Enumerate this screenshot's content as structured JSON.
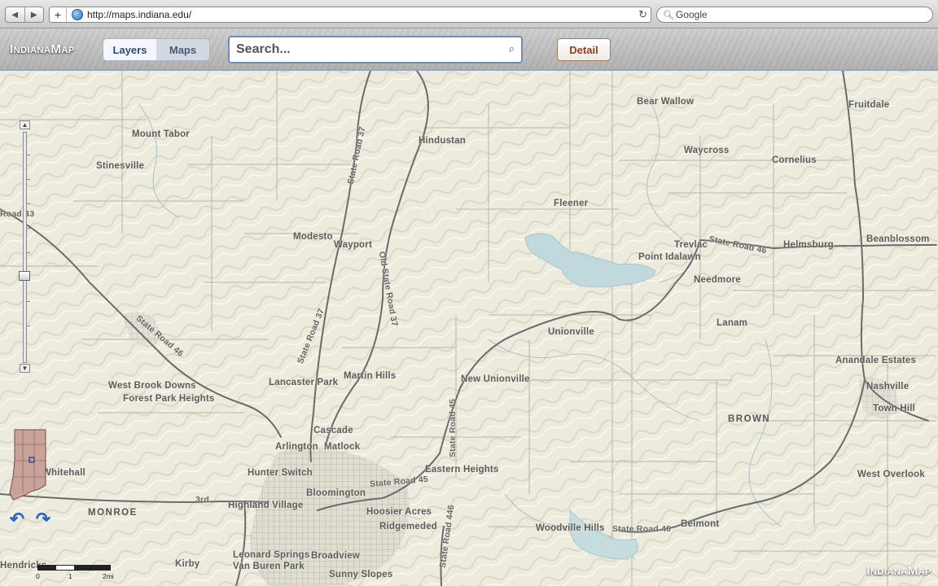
{
  "browser": {
    "back_icon": "back-arrow-icon",
    "forward_icon": "forward-arrow-icon",
    "new_tab": "+",
    "url": "http://maps.indiana.edu/",
    "search_engine": "Google"
  },
  "app": {
    "logo": "IndianaMap",
    "tabs": [
      "Layers",
      "Maps"
    ],
    "search_placeholder": "Search...",
    "detail_button": "Detail",
    "watermark": "IndianaMap"
  },
  "map": {
    "places": [
      "Mount Tabor",
      "Stinesville",
      "Hindustan",
      "Bear Wallow",
      "Fruitdale",
      "Waycross",
      "Cornelius",
      "Fleener",
      "Modesto",
      "Wayport",
      "Trevlac",
      "Helmsburg",
      "Beanblossom",
      "Point Idalawn",
      "Needmore",
      "Lanam",
      "Unionville",
      "West Brook Downs",
      "Forest Park Heights",
      "Lancaster Park",
      "Martin Hills",
      "New Unionville",
      "Anandale Estates",
      "Nashville",
      "Town Hill",
      "Cascade",
      "Arlington",
      "Matlock",
      "Hunter Switch",
      "Bloomington",
      "Eastern Heights",
      "West Overlook",
      "Highland Village",
      "Hoosier Acres",
      "Ridgemeded",
      "Woodville Hills",
      "Belmont",
      "Leonard Springs",
      "Van Buren Park",
      "Broadview",
      "Sunny Slopes",
      "Kirby",
      "Hendricks",
      "Whitehall"
    ],
    "roads": [
      "State Road 37",
      "Old State Road 37",
      "State Road 46",
      "State Road 45",
      "State Road 446",
      "3rd",
      "Road 43"
    ],
    "counties": [
      "MONROE",
      "BROWN"
    ],
    "scale_labels": [
      "0",
      "1",
      "2mi"
    ]
  }
}
